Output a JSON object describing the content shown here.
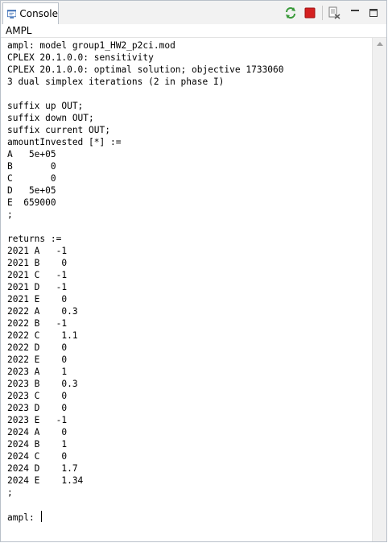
{
  "view": {
    "tab_label": "Console",
    "subtitle": "AMPL"
  },
  "toolbar": {
    "icons": [
      "console-view-icon",
      "refresh-icon",
      "terminate-icon",
      "clear-console-icon",
      "minimize-icon",
      "maximize-icon"
    ]
  },
  "console": {
    "lines": [
      "ampl: model group1_HW2_p2ci.mod",
      "CPLEX 20.1.0.0: sensitivity",
      "CPLEX 20.1.0.0: optimal solution; objective 1733060",
      "3 dual simplex iterations (2 in phase I)",
      "",
      "suffix up OUT;",
      "suffix down OUT;",
      "suffix current OUT;",
      "amountInvested [*] :=",
      "A   5e+05",
      "B       0",
      "C       0",
      "D   5e+05",
      "E  659000",
      ";",
      "",
      "returns :=",
      "2021 A   -1",
      "2021 B    0",
      "2021 C   -1",
      "2021 D   -1",
      "2021 E    0",
      "2022 A    0.3",
      "2022 B   -1",
      "2022 C    1.1",
      "2022 D    0",
      "2022 E    0",
      "2023 A    1",
      "2023 B    0.3",
      "2023 C    0",
      "2023 D    0",
      "2023 E   -1",
      "2024 A    0",
      "2024 B    1",
      "2024 C    0",
      "2024 D    1.7",
      "2024 E    1.34",
      ";",
      ""
    ],
    "prompt": "ampl: "
  },
  "colors": {
    "refresh": "#3a9a3a",
    "terminate": "#d42020",
    "border": "#b9c0c9"
  }
}
